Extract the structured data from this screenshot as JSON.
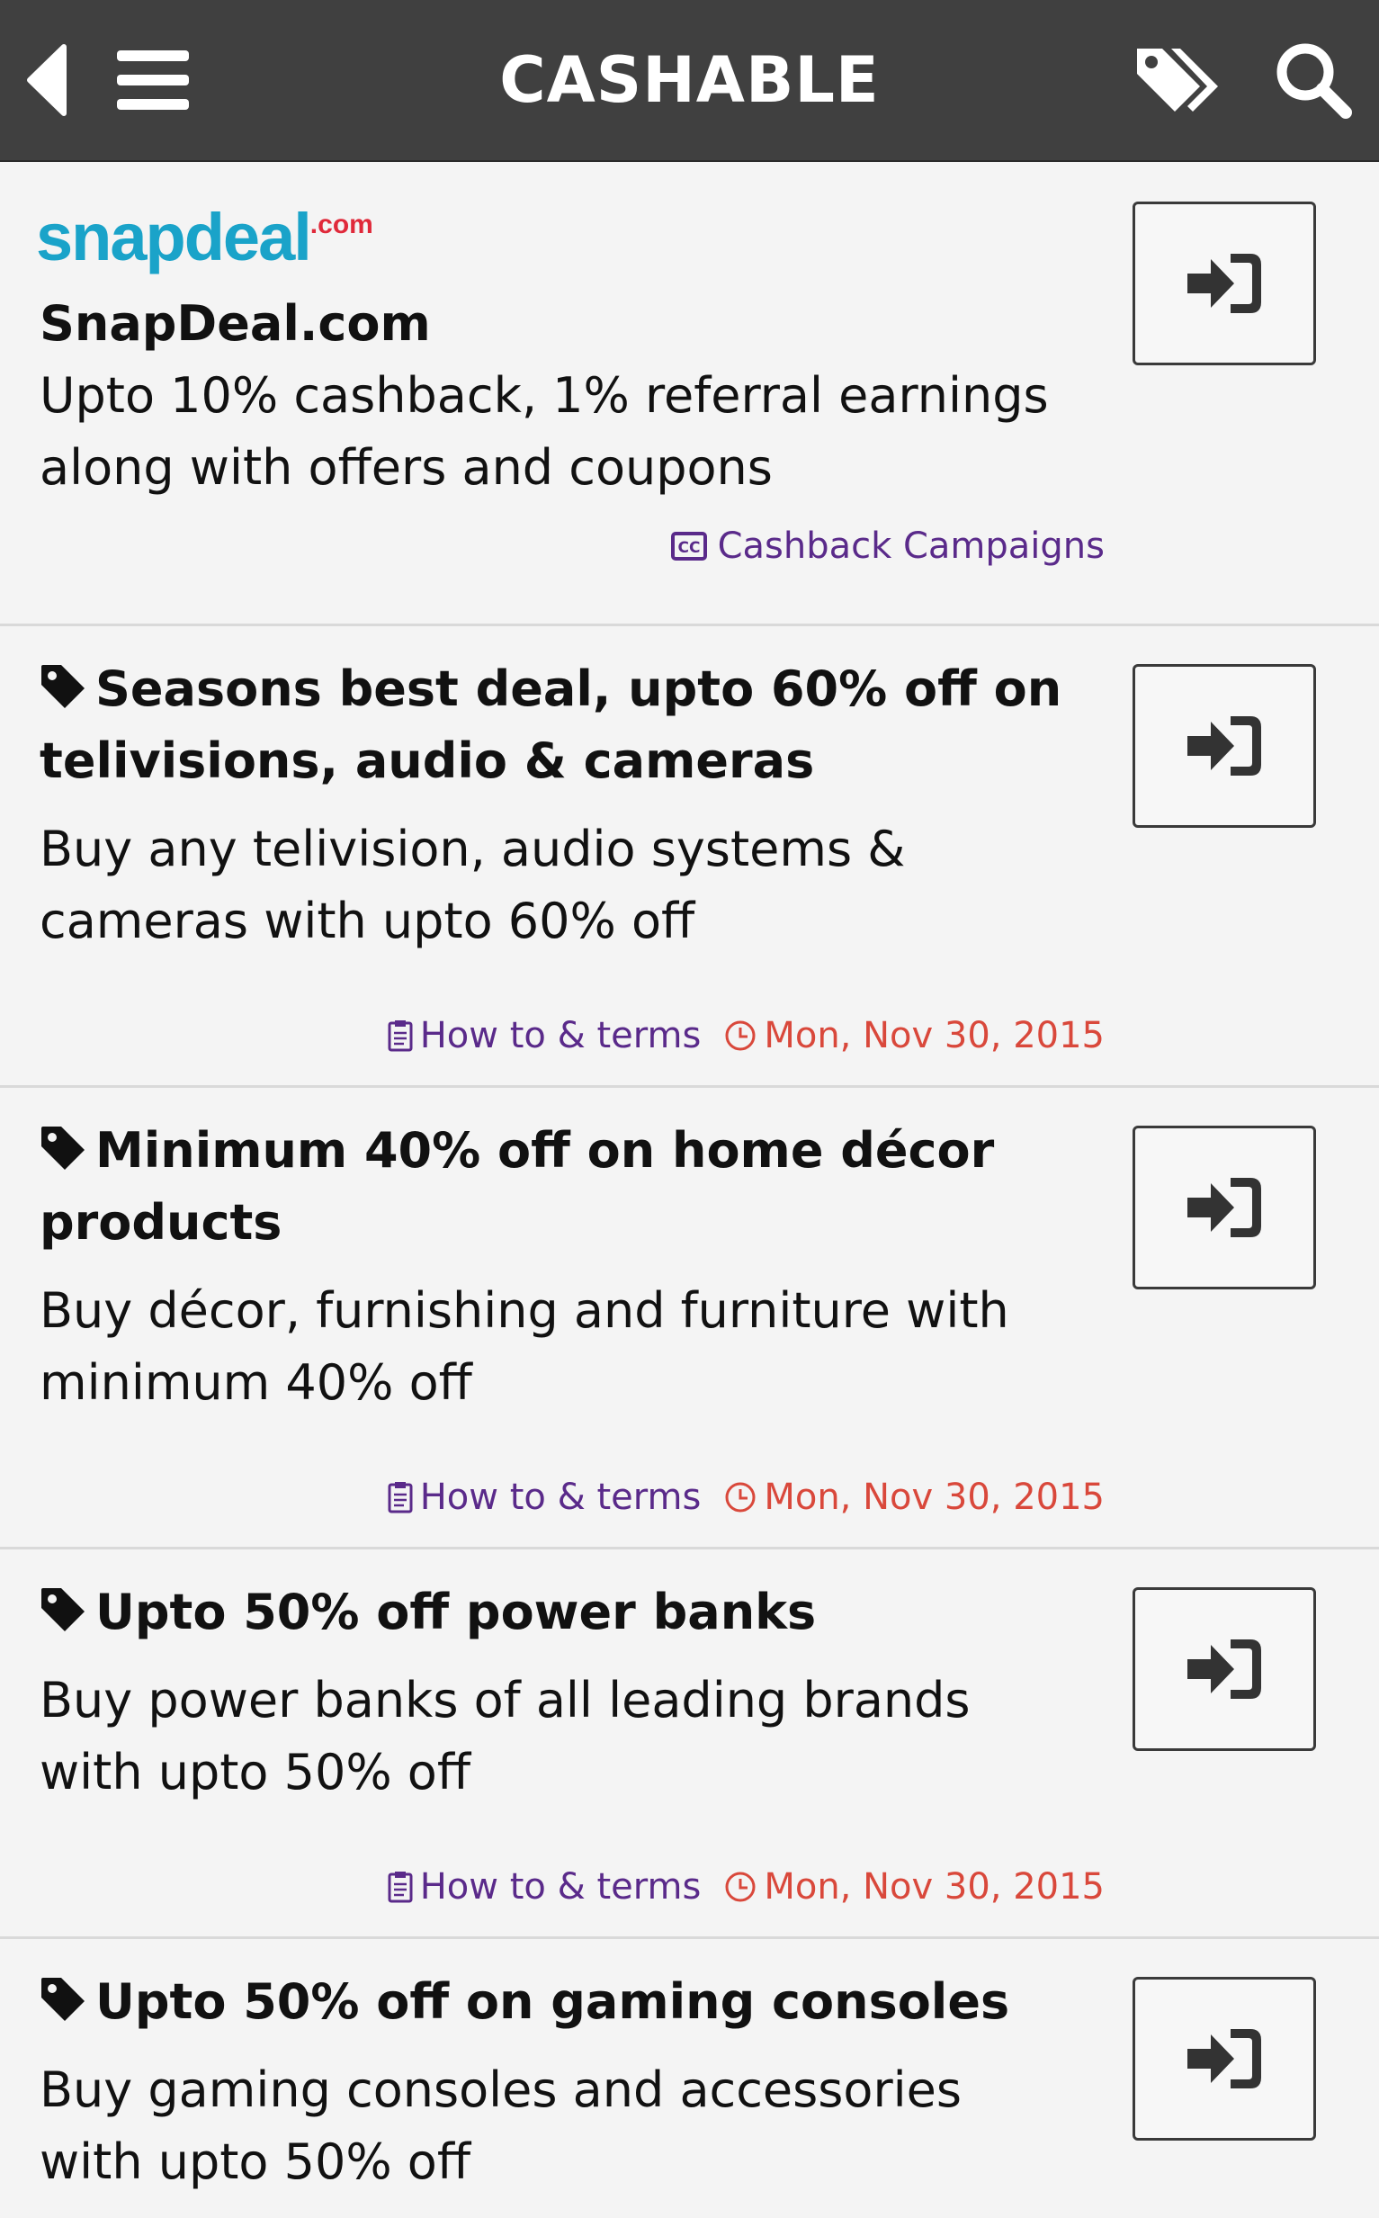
{
  "header": {
    "title": "CASHABLE"
  },
  "store": {
    "logo_text": "snapdeal",
    "logo_suffix": ".com",
    "name": "SnapDeal.com",
    "description": "Upto 10% cashback, 1% referral earnings along with offers and coupons",
    "campaign_link": "Cashback Campaigns"
  },
  "deals": [
    {
      "title": "Seasons best deal, upto 60% off on telivisions, audio & cameras",
      "description": "Buy any telivision, audio systems & cameras with upto 60% off",
      "terms": "How to & terms",
      "date": "Mon, Nov 30, 2015"
    },
    {
      "title": "Minimum 40% off on home décor products",
      "description": "Buy décor, furnishing and furniture with minimum 40% off",
      "terms": "How to & terms",
      "date": "Mon, Nov 30, 2015"
    },
    {
      "title": "Upto 50% off power banks",
      "description": "Buy power banks of all leading brands with upto 50% off",
      "terms": "How to & terms",
      "date": "Mon, Nov 30, 2015"
    },
    {
      "title": "Upto 50% off on gaming consoles",
      "description": "Buy gaming consoles and accessories with upto 50% off",
      "terms": "",
      "date": ""
    }
  ],
  "colors": {
    "header_bg": "#404040",
    "logo_teal": "#1aa3c9",
    "logo_red": "#e0293a",
    "link_purple": "#5a2a8a",
    "date_red": "#d9483b"
  },
  "icons": {
    "back": "back-icon",
    "menu": "menu-icon",
    "tags": "tags-icon",
    "search": "search-icon",
    "login": "sign-in-icon",
    "tag": "tag-icon",
    "clipboard": "clipboard-icon",
    "clock": "clock-icon",
    "cc": "cc-icon"
  }
}
